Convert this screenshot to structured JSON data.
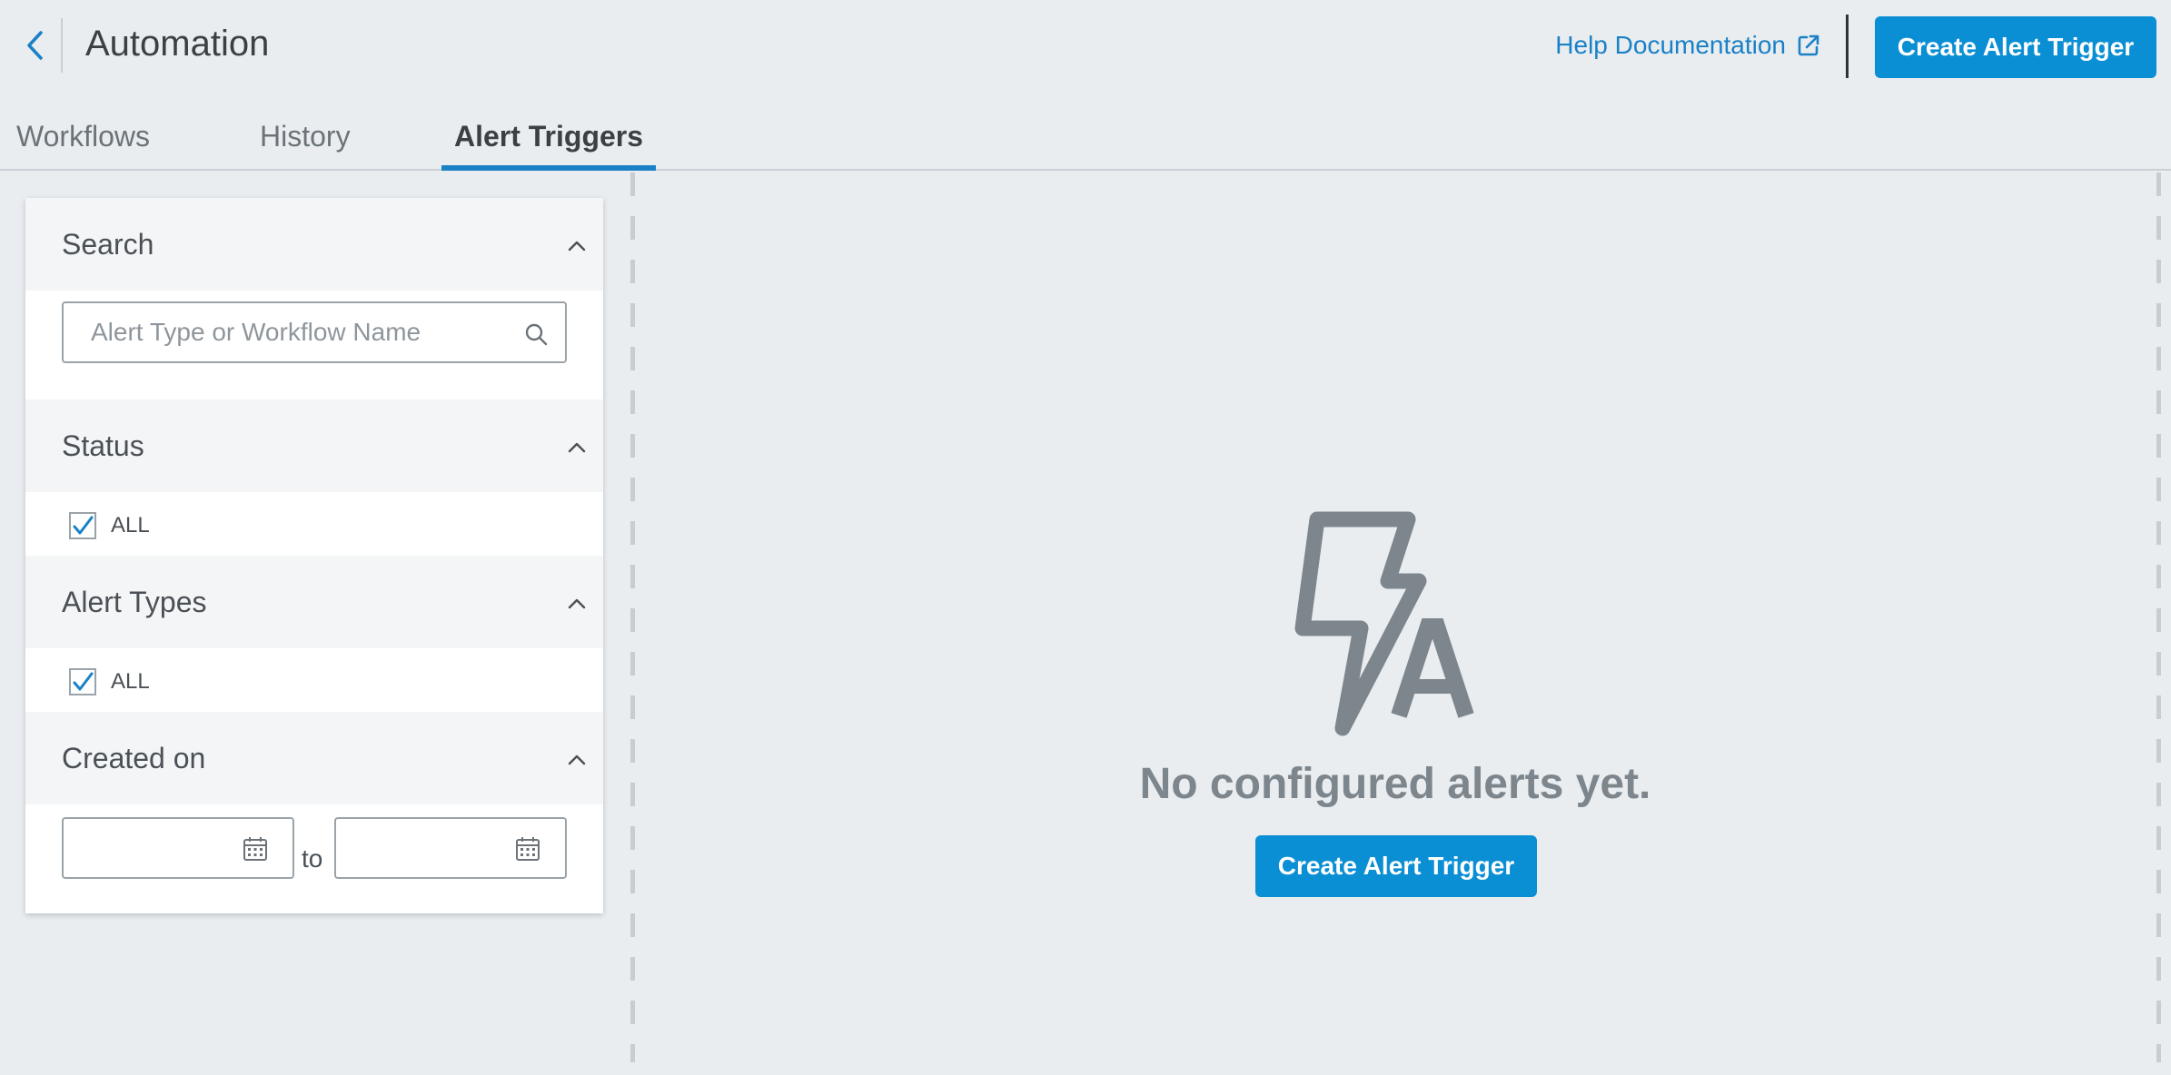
{
  "header": {
    "title": "Automation",
    "help_link": "Help Documentation",
    "create_button": "Create Alert Trigger"
  },
  "tabs": [
    {
      "label": "Workflows",
      "active": false
    },
    {
      "label": "History",
      "active": false
    },
    {
      "label": "Alert Triggers",
      "active": true
    }
  ],
  "filters": {
    "search": {
      "title": "Search",
      "placeholder": "Alert Type or Workflow Name",
      "value": ""
    },
    "status": {
      "title": "Status",
      "options": [
        {
          "label": "ALL",
          "checked": true
        }
      ]
    },
    "alert_types": {
      "title": "Alert Types",
      "options": [
        {
          "label": "ALL",
          "checked": true
        }
      ]
    },
    "created_on": {
      "title": "Created on",
      "from_value": "",
      "to_label": "to",
      "to_value": ""
    }
  },
  "empty_state": {
    "message": "No configured alerts yet.",
    "button": "Create Alert Trigger"
  },
  "colors": {
    "accent": "#0b8fd4",
    "link": "#1a81c6",
    "background": "#e9edf0",
    "illustration": "#7d868d"
  },
  "icons": {
    "back": "chevron-left-icon",
    "external_link": "external-link-icon",
    "collapse": "chevron-up-icon",
    "search": "search-icon",
    "calendar": "calendar-icon",
    "empty": "lightning-alert-icon"
  }
}
